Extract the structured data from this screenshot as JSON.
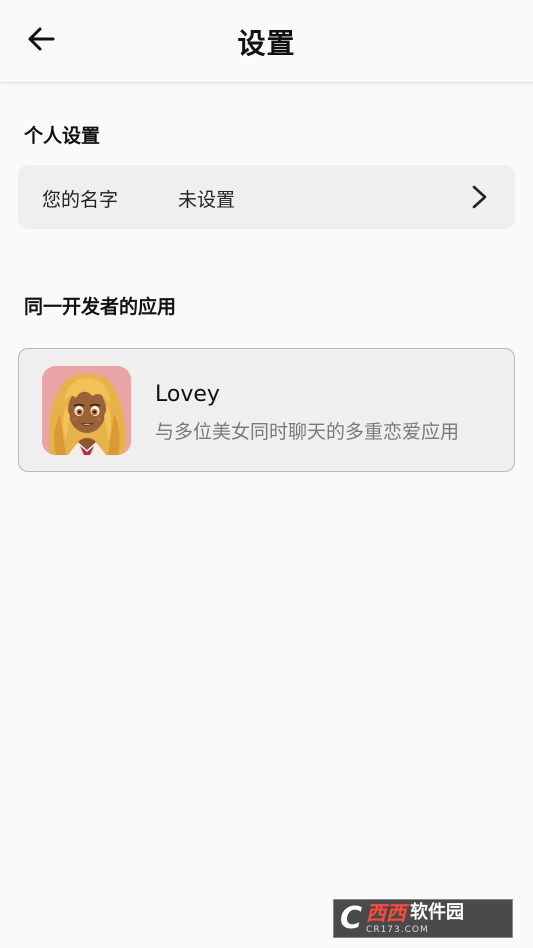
{
  "header": {
    "title": "设置",
    "back_icon": "arrow-left-icon"
  },
  "personal_section": {
    "title": "个人设置",
    "name_row": {
      "label": "您的名字",
      "value": "未设置",
      "chevron_icon": "chevron-right-icon"
    }
  },
  "developer_section": {
    "title": "同一开发者的应用",
    "apps": [
      {
        "name": "Lovey",
        "description": "与多位美女同时聊天的多重恋爱应用",
        "icon": "lovey-app-icon"
      }
    ]
  },
  "watermark": {
    "logo_letter": "C",
    "brand": "西西",
    "brand_suffix": "软件园",
    "url": "CR173.COM"
  },
  "colors": {
    "background": "#fafafa",
    "card": "#efefef",
    "secondary_text": "#7a7a7a"
  }
}
